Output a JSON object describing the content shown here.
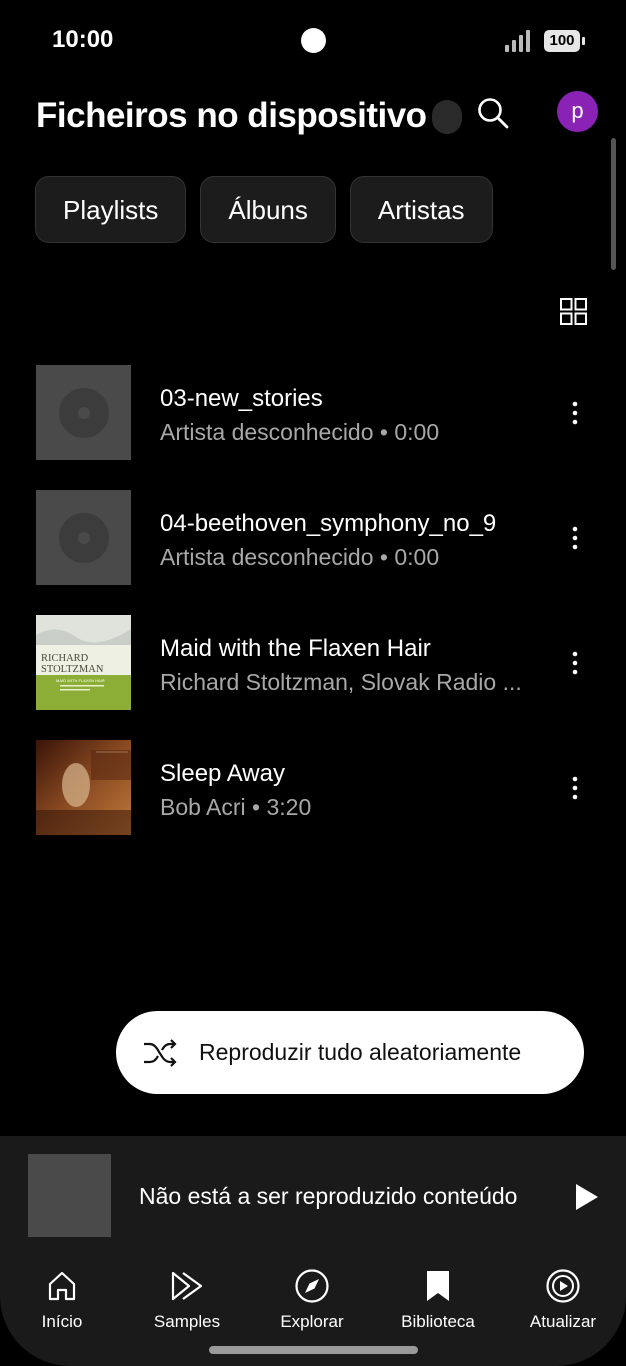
{
  "status_bar": {
    "time": "10:00",
    "battery": "100"
  },
  "header": {
    "title": "Ficheiros no dispositivo",
    "avatar_letter": "p"
  },
  "chips": [
    {
      "label": "Playlists"
    },
    {
      "label": "Álbuns"
    },
    {
      "label": "Artistas"
    }
  ],
  "tracks": [
    {
      "title": "03-new_stories",
      "subtitle": "Artista desconhecido • 0:00"
    },
    {
      "title": "04-beethoven_symphony_no_9",
      "subtitle": "Artista desconhecido • 0:00"
    },
    {
      "title": "Maid with the Flaxen Hair",
      "subtitle": "Richard Stoltzman, Slovak Radio ...",
      "art_text": [
        "RICHARD",
        "STOLTZMAN",
        "MAID WITH FLAXEN HAIR"
      ]
    },
    {
      "title": "Sleep Away",
      "subtitle": "Bob Acri • 3:20"
    }
  ],
  "shuffle_button": {
    "label": "Reproduzir tudo aleatoriamente"
  },
  "mini_player": {
    "text": "Não está a ser reproduzido conteúdo"
  },
  "bottom_nav": [
    {
      "label": "Início",
      "icon": "home-icon"
    },
    {
      "label": "Samples",
      "icon": "samples-icon"
    },
    {
      "label": "Explorar",
      "icon": "compass-icon"
    },
    {
      "label": "Biblioteca",
      "icon": "bookmark-icon"
    },
    {
      "label": "Atualizar",
      "icon": "upgrade-icon"
    }
  ],
  "colors": {
    "background": "#000000",
    "avatar": "#8a22b6",
    "surface": "#1a1a1a",
    "chip": "#1c1c1c"
  }
}
